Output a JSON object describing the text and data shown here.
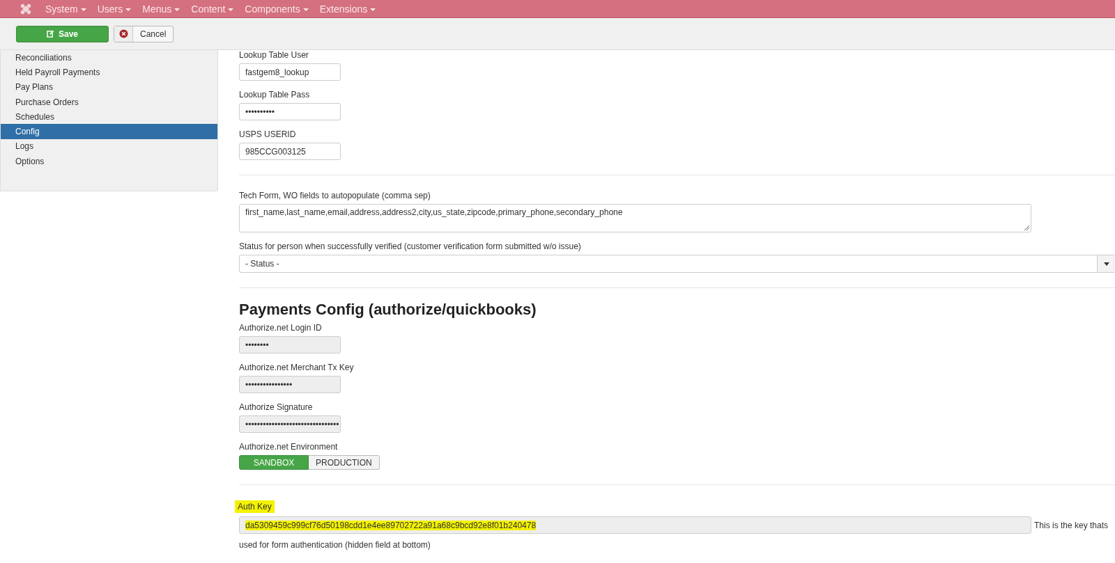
{
  "nav": {
    "items": [
      {
        "label": "System"
      },
      {
        "label": "Users"
      },
      {
        "label": "Menus"
      },
      {
        "label": "Content"
      },
      {
        "label": "Components"
      },
      {
        "label": "Extensions"
      }
    ]
  },
  "toolbar": {
    "save": "Save",
    "cancel": "Cancel"
  },
  "sidebar": {
    "items": [
      {
        "label": "Reconciliations",
        "selected": false
      },
      {
        "label": "Held Payroll Payments",
        "selected": false
      },
      {
        "label": "Pay Plans",
        "selected": false
      },
      {
        "label": "Purchase Orders",
        "selected": false
      },
      {
        "label": "Schedules",
        "selected": false
      },
      {
        "label": "Config",
        "selected": true
      },
      {
        "label": "Logs",
        "selected": false
      },
      {
        "label": "Options",
        "selected": false
      }
    ]
  },
  "lookup_fields": [
    {
      "label": "Lookup Table User",
      "value": "fastgem8_lookup"
    },
    {
      "label": "Lookup Table Pass",
      "value": "••••••••••"
    },
    {
      "label": "USPS USERID",
      "value": "985CCG003125"
    }
  ],
  "autopopulate": {
    "label": "Tech Form, WO fields to autopopulate (comma sep)",
    "value": "first_name,last_name,email,address,address2,city,us_state,zipcode,primary_phone,secondary_phone"
  },
  "status_select": {
    "label": "Status for person when successfully verified (customer verification form submitted w/o issue)",
    "value": "- Status -"
  },
  "payments": {
    "heading": "Payments Config (authorize/quickbooks)",
    "fields": [
      {
        "label": "Authorize.net Login ID",
        "value": "••••••••"
      },
      {
        "label": "Authorize.net Merchant Tx Key",
        "value": "••••••••••••••••"
      },
      {
        "label": "Authorize Signature",
        "value": "••••••••••••••••••••••••••••••••"
      }
    ],
    "environment": {
      "label": "Authorize.net Environment",
      "options": [
        {
          "label": "SANDBOX",
          "selected": true
        },
        {
          "label": "PRODUCTION",
          "selected": false
        }
      ]
    }
  },
  "auth_key": {
    "label": "Auth Key",
    "label_highlighted": true,
    "value": "da5309459c999cf76d50198cdd1e4ee89702722a91a68c9bcd92e8f01b240478",
    "value_highlighted": true,
    "help_lines": [
      "This is the key thats",
      "used for form authentication (hidden field at bottom)"
    ]
  }
}
